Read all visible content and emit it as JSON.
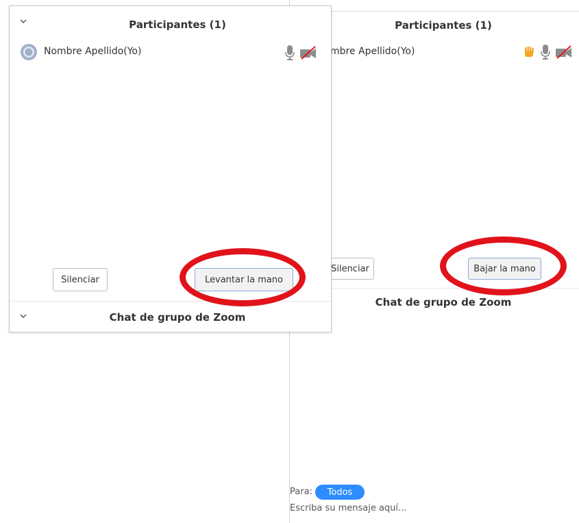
{
  "right_panel": {
    "title": "Participantes (1)",
    "participant_name": "mbre Apellido(Yo)",
    "silenciar_label": "Silenciar",
    "bajar_label": "Bajar la mano",
    "chat_title": "Chat de grupo de Zoom",
    "para_label": "Para:",
    "todos_label": "Todos",
    "message_placeholder": "Escriba su mensaje aquí..."
  },
  "left_window": {
    "title": "Participantes (1)",
    "participant_name": "Nombre Apellido(Yo)",
    "silenciar_label": "Silenciar",
    "levantar_label": "Levantar la mano",
    "chat_title": "Chat de grupo de Zoom"
  },
  "icons": {
    "collapse": "chevron-down-icon",
    "avatar": "avatar-icon",
    "microphone": "microphone-icon",
    "video_off": "video-off-icon",
    "raised_hand": "raised-hand-icon"
  },
  "colors": {
    "accent_blue": "#2d8cff",
    "annotation_red": "#e0131b",
    "hand_orange": "#f5a623",
    "mic_gray": "#8c8c8c",
    "video_off_red": "#e0131b"
  }
}
